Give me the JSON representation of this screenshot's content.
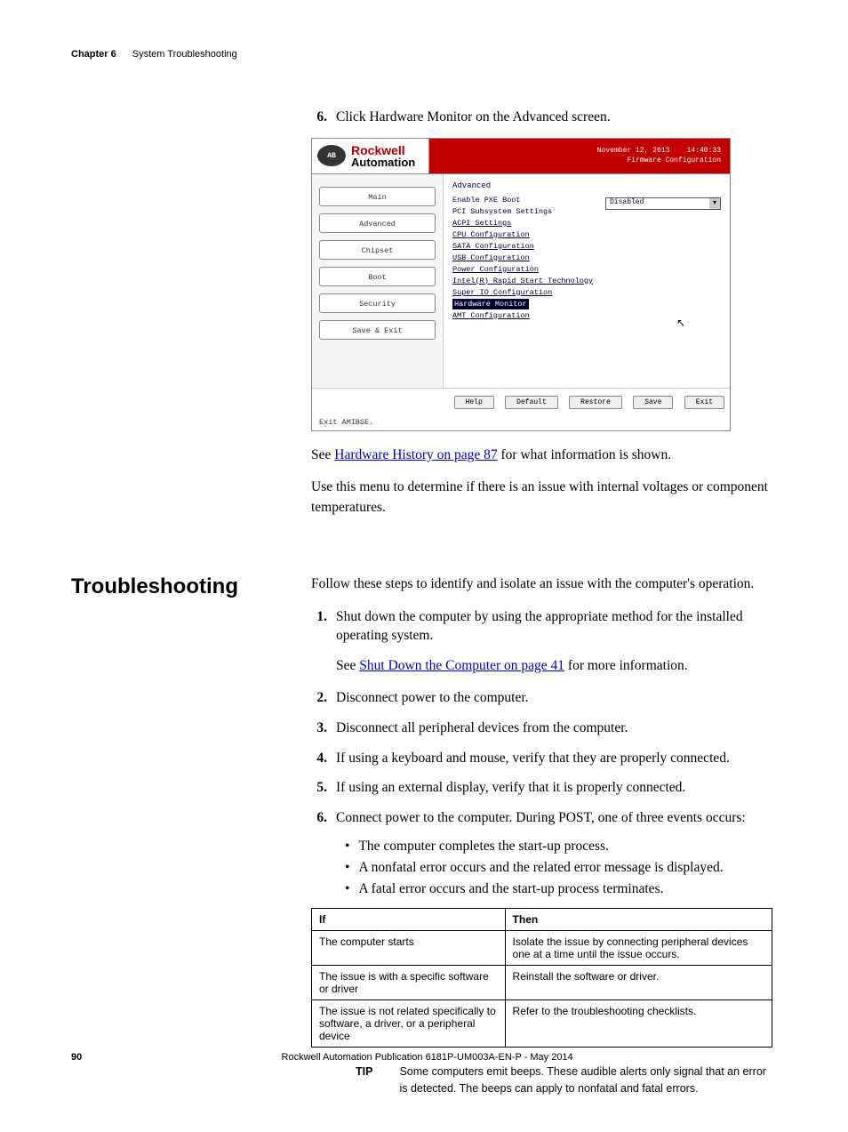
{
  "header": {
    "chapter": "Chapter 6",
    "title": "System Troubleshooting"
  },
  "pre_section": {
    "step6_num": "6.",
    "step6_text": "Click Hardware Monitor on the Advanced screen.",
    "see_text_a": "See ",
    "see_link": "Hardware History on page 87",
    "see_text_b": " for what information is shown.",
    "use_text": "Use this menu to determine if there is an issue with internal voltages or component temperatures."
  },
  "bios": {
    "brand1": "Rockwell",
    "brand2": "Automation",
    "logo": "AB",
    "date": "November 12, 2013",
    "time": "14:40:33",
    "fw": "Firmware Configuration",
    "nav": [
      "Main",
      "Advanced",
      "Chipset",
      "Boot",
      "Security",
      "Save & Exit"
    ],
    "adv_title": "Advanced",
    "opt_label": "Enable PXE Boot",
    "opt_value": "Disabled",
    "items": [
      "PCI Subsystem Settings",
      "ACPI Settings",
      "CPU Configuration",
      "SATA Configuration",
      "USB Configuration",
      "Power Configuration",
      "Intel(R) Rapid Start Technology",
      "Super IO Configuration",
      "Hardware Monitor",
      "AMT Configuration"
    ],
    "buttons": [
      "Help",
      "Default",
      "Restore",
      "Save",
      "Exit"
    ],
    "status": "Exit AMIBSE.",
    "cursor": "↖"
  },
  "troubleshoot": {
    "heading": "Troubleshooting",
    "intro": "Follow these steps to identify and isolate an issue with the computer's operation.",
    "steps": [
      {
        "n": "1.",
        "t": "Shut down the computer by using the appropriate method for the installed operating system."
      },
      {
        "n": "2.",
        "t": "Disconnect power to the computer."
      },
      {
        "n": "3.",
        "t": "Disconnect all peripheral devices from the computer."
      },
      {
        "n": "4.",
        "t": "If using a keyboard and mouse, verify that they are properly connected."
      },
      {
        "n": "5.",
        "t": "If using an external display, verify that it is properly connected."
      },
      {
        "n": "6.",
        "t": "Connect power to the computer. During POST, one of three events occurs:"
      }
    ],
    "step1_see_a": "See ",
    "step1_link": "Shut Down the Computer on page 41",
    "step1_see_b": " for more information.",
    "bullets": [
      "The computer completes the start-up process.",
      "A nonfatal error occurs and the related error message is displayed.",
      "A fatal error occurs and the start-up process terminates."
    ],
    "table": {
      "headers": [
        "If",
        "Then"
      ],
      "rows": [
        [
          "The computer starts",
          "Isolate the issue by connecting peripheral devices one at a time until the issue occurs."
        ],
        [
          "The issue is with a specific software or driver",
          "Reinstall the software or driver."
        ],
        [
          "The issue is not related specifically to software, a driver, or a peripheral device",
          "Refer to the troubleshooting checklists."
        ]
      ]
    },
    "tip_label": "TIP",
    "tip_text": "Some computers emit beeps. These audible alerts only signal that an error is detected. The beeps can apply to nonfatal and fatal errors."
  },
  "footer": {
    "page": "90",
    "pub": "Rockwell Automation Publication 6181P-UM003A-EN-P - May 2014"
  }
}
